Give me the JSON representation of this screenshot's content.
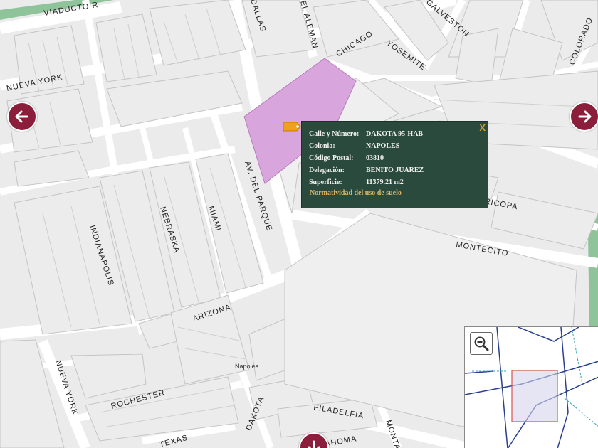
{
  "map": {
    "streets": {
      "viaducto": "VIADUCTO R",
      "dallas": "DALLAS",
      "el_aleman": "EL ALEMAN",
      "galveston": "GALVESTON",
      "colorado": "COLORADO",
      "chicago": "CHICAGO",
      "yosemite": "YOSEMITE",
      "nueva_york_top": "NUEVA YORK",
      "av_del_parque": "AV. DEL PARQUE",
      "maricopa": "MARICOPA",
      "montecito": "MONTECITO",
      "indianapolis": "INDIANAPOLIS",
      "nebraska": "NEBRASKA",
      "miami": "MIAMI",
      "arizona": "ARIZONA",
      "napoles": "Napoles",
      "nueva_york_bottom": "NUEVA YORK",
      "rochester": "ROCHESTER",
      "dakota": "DAKOTA",
      "filadelfia": "FILADELFIA",
      "texas": "TEXAS",
      "oklahoma": "AHOMA",
      "montana": "MONTA"
    },
    "colors": {
      "background": "#ebebeb",
      "road": "#ffffff",
      "block_outline": "#c8c8c8",
      "highlight_parcel": "#d9a5dd",
      "green_strip": "#8fc49b",
      "nav_button": "#8b1f3b",
      "popup_bg": "#2b4a3e",
      "popup_accent": "#d9a21b"
    }
  },
  "popup": {
    "close_label": "X",
    "rows": [
      {
        "label": "Calle y Número:",
        "value": "DAKOTA 95-HAB"
      },
      {
        "label": "Colonia:",
        "value": "NAPOLES"
      },
      {
        "label": "Código Postal:",
        "value": "03810"
      },
      {
        "label": "Delegación:",
        "value": "BENITO JUAREZ"
      },
      {
        "label": "Superficie:",
        "value": "11379.21 m2"
      }
    ],
    "link_label": "Normatividad del uso de suelo"
  },
  "navigation": {
    "left_icon": "arrow-left-icon",
    "right_icon": "arrow-right-icon",
    "down_icon": "arrow-down-icon"
  },
  "overview": {
    "zoom_icon": "zoom-out-icon"
  }
}
